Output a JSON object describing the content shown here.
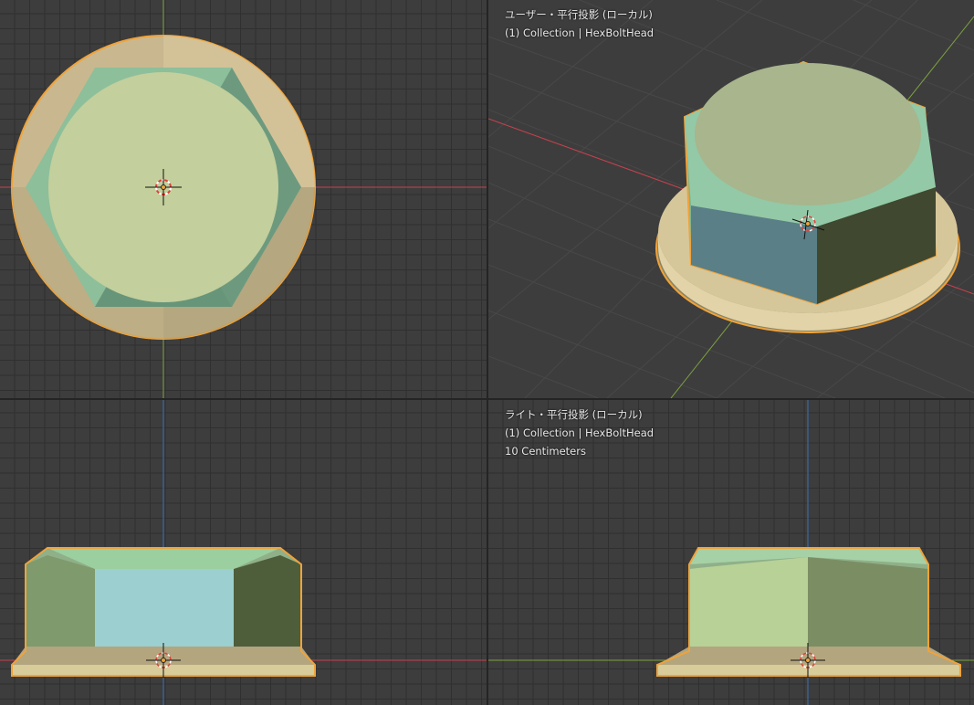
{
  "viewports": {
    "top": {
      "name": "Top viewport"
    },
    "user": {
      "view_label": "ユーザー・平行投影 (ローカル)",
      "collection_label": "(1) Collection | HexBoltHead"
    },
    "front": {
      "name": "Front viewport"
    },
    "right": {
      "view_label": "ライト・平行投影 (ローカル)",
      "collection_label": "(1) Collection | HexBoltHead",
      "scale_label": "10 Centimeters"
    }
  },
  "colors": {
    "x_axis": "#c8414e",
    "y_axis": "#7da33f",
    "z_axis": "#3d6fb8",
    "selection_outline": "#f0a33a"
  }
}
